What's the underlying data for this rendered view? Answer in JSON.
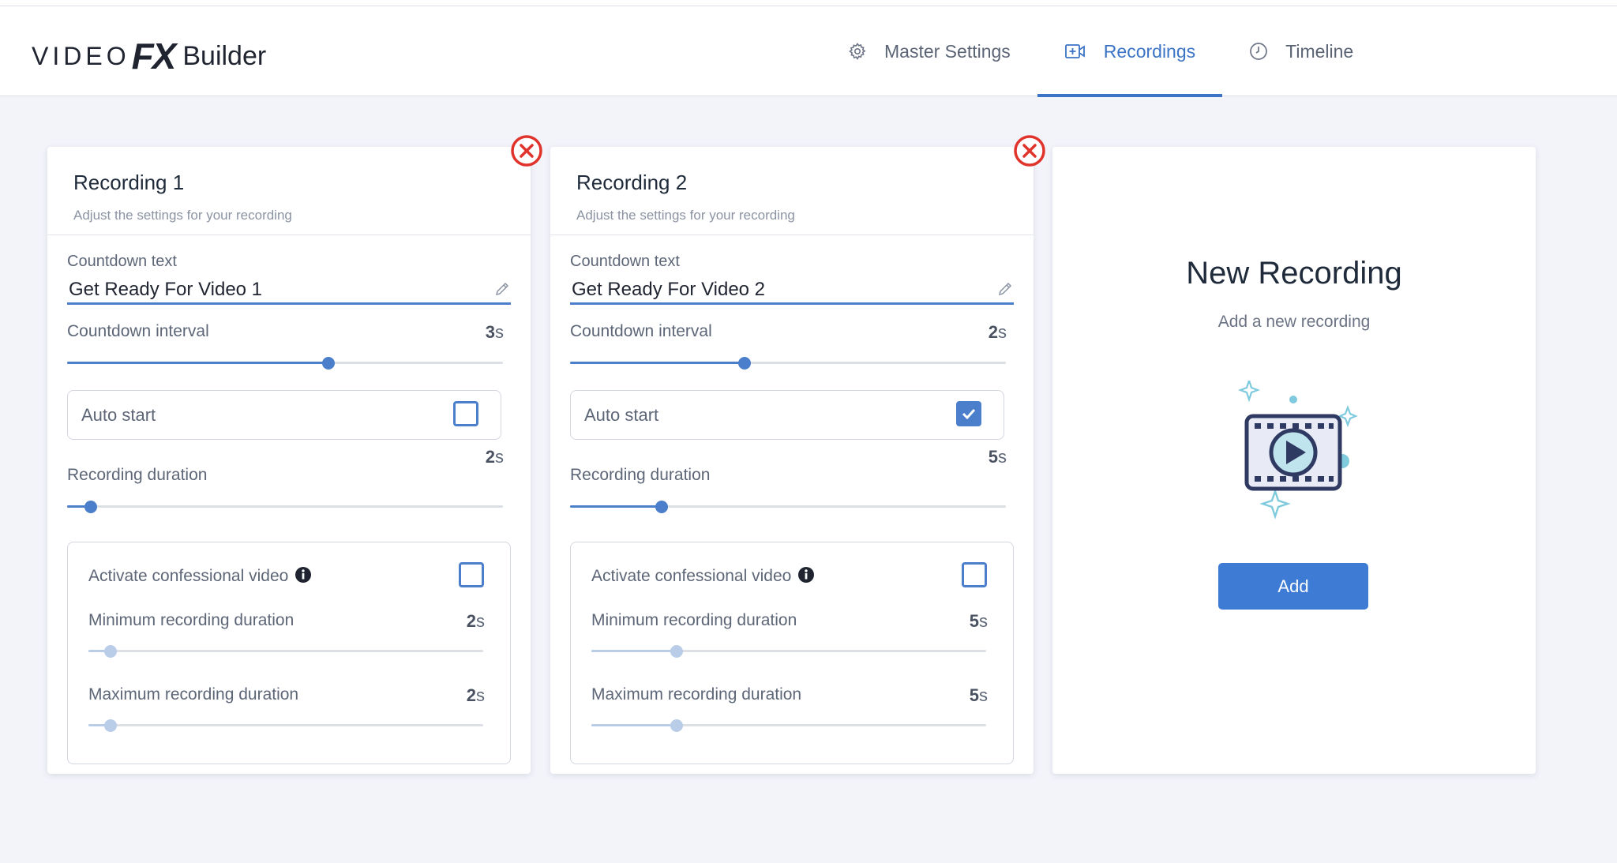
{
  "app": {
    "logo": {
      "video": "VIDEO",
      "fx": "FX",
      "builder": "Builder"
    },
    "tabs": [
      {
        "label": "Master Settings",
        "icon": "gear-icon",
        "active": false
      },
      {
        "label": "Recordings",
        "icon": "video-add-icon",
        "active": true
      },
      {
        "label": "Timeline",
        "icon": "clock-icon",
        "active": false
      }
    ]
  },
  "recordings": [
    {
      "title": "Recording 1",
      "subtitle": "Adjust the settings for your recording",
      "countdown_text_label": "Countdown text",
      "countdown_text_value": "Get Ready For Video 1",
      "countdown_interval_label": "Countdown interval",
      "countdown_interval_num": "3",
      "countdown_interval_unit": "s",
      "countdown_interval_fraction": 0.6,
      "auto_start_label": "Auto start",
      "auto_start_checked": false,
      "recording_duration_label": "Recording duration",
      "recording_duration_num": "2",
      "recording_duration_unit": "s",
      "recording_duration_fraction": 0.055,
      "confessional_label": "Activate confessional video",
      "confessional_checked": false,
      "min_duration_label": "Minimum recording duration",
      "min_duration_num": "2",
      "min_duration_unit": "s",
      "min_duration_fraction": 0.055,
      "max_duration_label": "Maximum recording duration",
      "max_duration_num": "2",
      "max_duration_unit": "s",
      "max_duration_fraction": 0.055
    },
    {
      "title": "Recording 2",
      "subtitle": "Adjust the settings for your recording",
      "countdown_text_label": "Countdown text",
      "countdown_text_value": "Get Ready For Video 2",
      "countdown_interval_label": "Countdown interval",
      "countdown_interval_num": "2",
      "countdown_interval_unit": "s",
      "countdown_interval_fraction": 0.4,
      "auto_start_label": "Auto start",
      "auto_start_checked": true,
      "recording_duration_label": "Recording duration",
      "recording_duration_num": "5",
      "recording_duration_unit": "s",
      "recording_duration_fraction": 0.21,
      "confessional_label": "Activate confessional video",
      "confessional_checked": false,
      "min_duration_label": "Minimum recording duration",
      "min_duration_num": "5",
      "min_duration_unit": "s",
      "min_duration_fraction": 0.215,
      "max_duration_label": "Maximum recording duration",
      "max_duration_num": "5",
      "max_duration_unit": "s",
      "max_duration_fraction": 0.215
    }
  ],
  "new_recording": {
    "title": "New Recording",
    "subtitle": "Add a new recording",
    "button_label": "Add",
    "illustration_icon": "film-play-icon"
  },
  "colors": {
    "accent": "#3b73c6",
    "close_red": "#e0332b",
    "background": "#f3f4fa",
    "illustration_teal": "#7fcbdd"
  }
}
